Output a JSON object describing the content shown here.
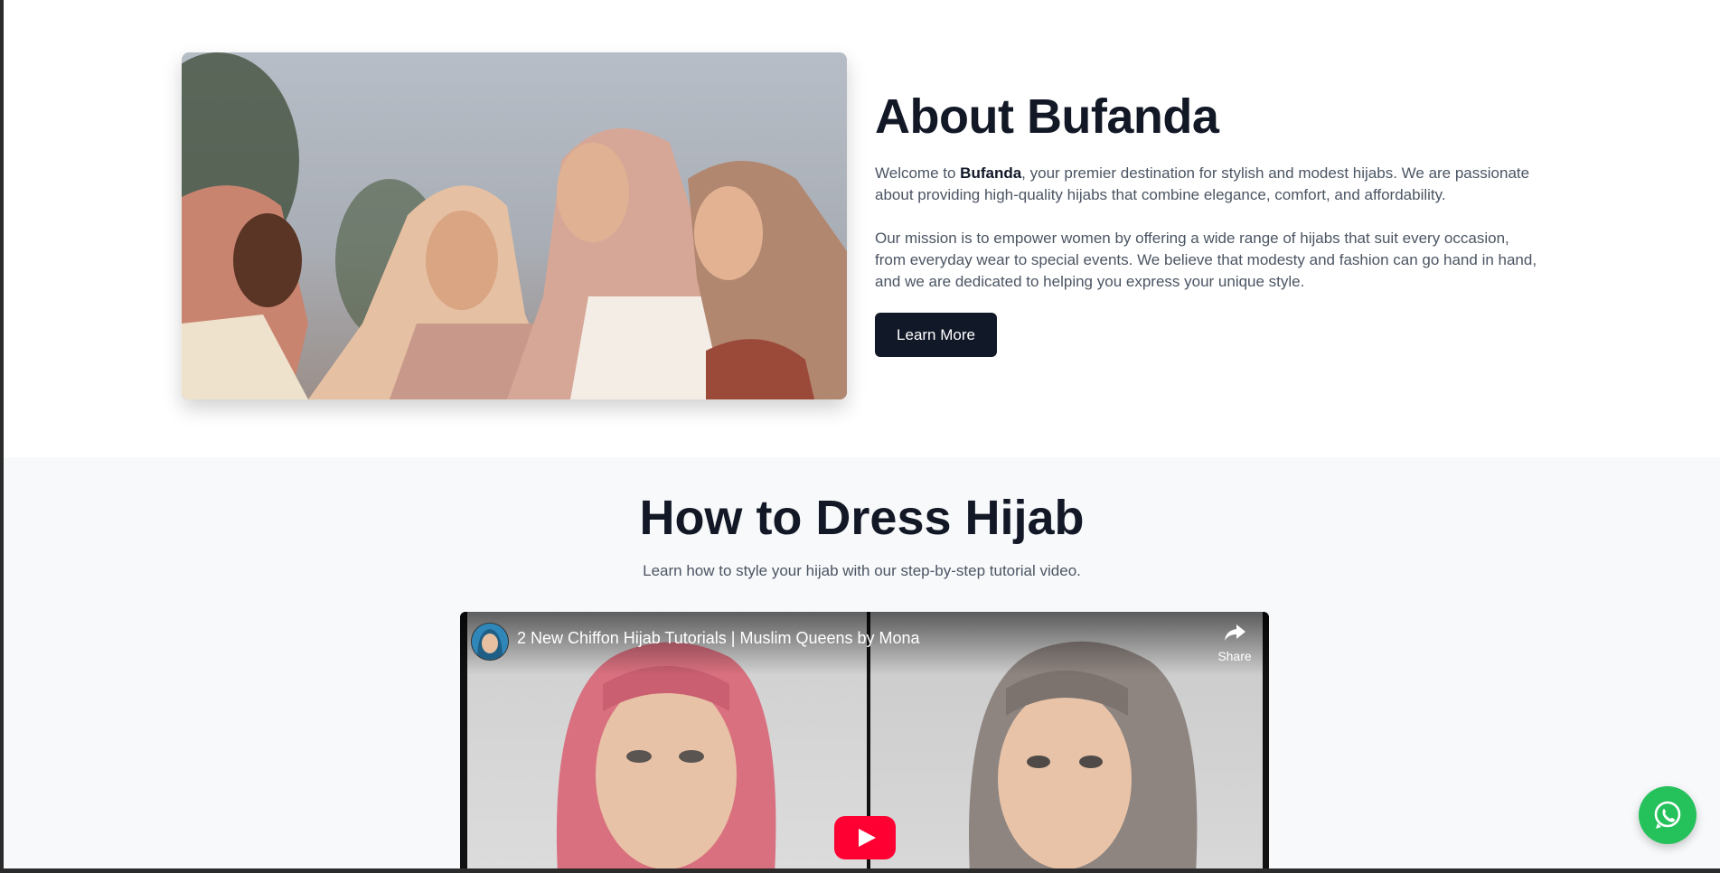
{
  "about": {
    "title": "About Bufanda",
    "p1_prefix": "Welcome to ",
    "p1_brand": "Bufanda",
    "p1_rest": ", your premier destination for stylish and modest hijabs. We are passionate about providing high-quality hijabs that combine elegance, comfort, and affordability.",
    "p2": "Our mission is to empower women by offering a wide range of hijabs that suit every occasion, from everyday wear to special events. We believe that modesty and fashion can go hand in hand, and we are dedicated to helping you express your unique style.",
    "button_label": "Learn More"
  },
  "tutorial": {
    "title": "How to Dress Hijab",
    "subtitle": "Learn how to style your hijab with our step-by-step tutorial video.",
    "video": {
      "title": "2 New Chiffon Hijab Tutorials | Muslim Queens by Mona",
      "share_label": "Share"
    }
  },
  "colors": {
    "dark": "#111827",
    "play_red": "#ff0033",
    "whatsapp_green": "#25c15b"
  },
  "icons": {
    "share": "share-arrow-icon",
    "play": "youtube-play-icon",
    "whatsapp": "whatsapp-icon"
  }
}
